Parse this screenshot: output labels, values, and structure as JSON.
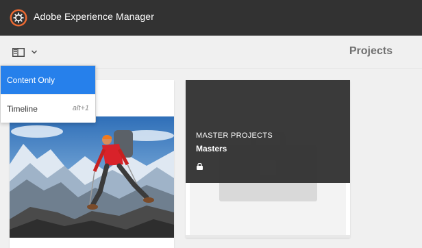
{
  "header": {
    "app_title": "Adobe Experience Manager",
    "logo_icon": "aem-logo-icon"
  },
  "actionbar": {
    "rail_toggle_icon": "rail-panel-icon",
    "chevron_icon": "chevron-down-icon",
    "page_title": "Projects"
  },
  "view_menu": {
    "items": [
      {
        "label": "Content Only",
        "shortcut": "",
        "selected": true
      },
      {
        "label": "Timeline",
        "shortcut": "alt+1",
        "selected": false
      }
    ]
  },
  "cards": [
    {
      "name": "project-card-hiker",
      "image": "hiker-mountain-photo"
    },
    {
      "name": "master-projects-card",
      "type_label": "MASTER PROJECTS",
      "title": "Masters",
      "status_icon": "lock-icon"
    }
  ],
  "colors": {
    "topbar": "#323232",
    "accent": "#2680eb",
    "logo_orange": "#eb6a32",
    "page_bg": "#f0f0f0"
  }
}
